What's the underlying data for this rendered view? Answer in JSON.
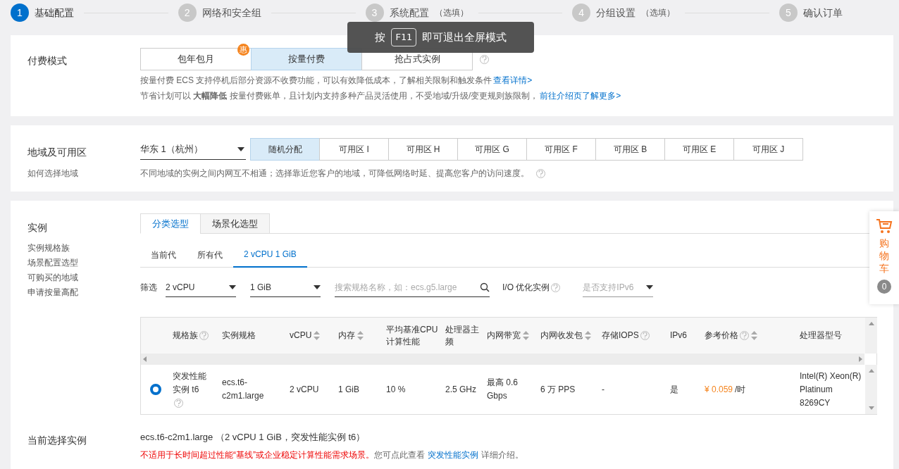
{
  "steps": [
    {
      "num": "1",
      "label": "基础配置",
      "selected": true
    },
    {
      "num": "2",
      "label": "网络和安全组",
      "selected": false
    },
    {
      "num": "3",
      "label": "系统配置",
      "note": "（选填）",
      "selected": false
    },
    {
      "num": "4",
      "label": "分组设置",
      "note": "（选填）",
      "selected": false
    },
    {
      "num": "5",
      "label": "确认订单",
      "selected": false
    }
  ],
  "toast": {
    "prefix": "按",
    "key": "F11",
    "suffix": "即可退出全屏模式"
  },
  "billing": {
    "label": "付费模式",
    "options": [
      {
        "label": "包年包月",
        "selected": false,
        "badge": "惠"
      },
      {
        "label": "按量付费",
        "selected": true
      },
      {
        "label": "抢占式实例",
        "selected": false
      }
    ],
    "notes": [
      {
        "text": "按量付费 ECS 支持停机后部分资源不收费功能，可以有效降低成本，了解相关限制和触发条件",
        "link": "查看详情>"
      },
      {
        "text": "节省计划可以 **大幅降低** 按量付费账单，且计划内支持多种产品灵活使用，不受地域/升级/变更规则族限制，",
        "link": "前往介绍页了解更多>"
      }
    ]
  },
  "region": {
    "label": "地域及可用区",
    "sublink": "如何选择地域",
    "select": "华东 1（杭州）",
    "zones": [
      {
        "label": "随机分配",
        "selected": true
      },
      {
        "label": "可用区 I",
        "selected": false
      },
      {
        "label": "可用区 H",
        "selected": false
      },
      {
        "label": "可用区 G",
        "selected": false
      },
      {
        "label": "可用区 F",
        "selected": false
      },
      {
        "label": "可用区 B",
        "selected": false
      },
      {
        "label": "可用区 E",
        "selected": false
      },
      {
        "label": "可用区 J",
        "selected": false
      }
    ],
    "note": "不同地域的实例之间内网互不相通；选择靠近您客户的地域，可降低网络时延、提高您客户的访问速度。"
  },
  "instance": {
    "label": "实例",
    "links": [
      "实例规格族",
      "场景配置选型",
      "可购买的地域",
      "申请按量高配"
    ],
    "tabs": [
      {
        "label": "分类选型",
        "selected": true
      },
      {
        "label": "场景化选型",
        "selected": false
      }
    ],
    "gen_tabs": [
      {
        "label": "当前代",
        "selected": false
      },
      {
        "label": "所有代",
        "selected": false
      },
      {
        "label": "2 vCPU 1 GiB",
        "selected": true
      }
    ],
    "filter_label": "筛选",
    "filters": [
      {
        "kind": "select",
        "value": "2 vCPU"
      },
      {
        "kind": "select",
        "value": "1 GiB"
      },
      {
        "kind": "search",
        "placeholder": "搜索规格名称，如：ecs.g5.large"
      },
      {
        "kind": "label",
        "text": "I/O 优化实例",
        "help": true
      },
      {
        "kind": "select",
        "placeholder": "是否支持IPv6"
      }
    ],
    "columns": [
      {},
      {
        "label": "规格族",
        "help": true
      },
      {
        "label": "实例规格"
      },
      {
        "label": "vCPU",
        "sort": true
      },
      {
        "label": "内存",
        "sort": true
      },
      {
        "label": "平均基准CPU计算性能"
      },
      {
        "label": "处理器主频"
      },
      {
        "label": "内网带宽",
        "sort": true
      },
      {
        "label": "内网收发包",
        "sort": true
      },
      {
        "label": "存储IOPS",
        "help": true
      },
      {
        "label": "IPv6"
      },
      {
        "label": "参考价格",
        "help": true,
        "sort": true
      },
      {
        "label": "处理器型号"
      }
    ],
    "row": [
      {
        "kind": "radio",
        "selected": true
      },
      {
        "kind": "text",
        "text": "突发性能实例 t6",
        "help": true
      },
      {
        "kind": "text",
        "text": "ecs.t6-c2m1.large"
      },
      {
        "kind": "text",
        "text": "2 vCPU"
      },
      {
        "kind": "text",
        "text": "1 GiB"
      },
      {
        "kind": "text",
        "text": "10 %"
      },
      {
        "kind": "text",
        "text": "2.5 GHz"
      },
      {
        "kind": "text",
        "text": "最高 0.6 Gbps"
      },
      {
        "kind": "text",
        "text": "6 万 PPS"
      },
      {
        "kind": "text",
        "text": "-"
      },
      {
        "kind": "text",
        "text": "是"
      },
      {
        "kind": "price",
        "value": "¥ 0.059",
        "unit": "/时"
      },
      {
        "kind": "text",
        "text": "Intel(R) Xeon(R) Platinum 8269CY"
      }
    ],
    "current_label": "当前选择实例",
    "current": "ecs.t6-c2m1.large （2 vCPU 1 GiB，突发性能实例 t6）",
    "warning": "不适用于长时间超过性能“基线”或企业稳定计算性能需求场景。",
    "hint_prefix": "您可点此查看",
    "hint_link": "突发性能实例",
    "hint_suffix": "详细介绍。"
  },
  "cart": {
    "label": "购物车",
    "count": "0"
  }
}
